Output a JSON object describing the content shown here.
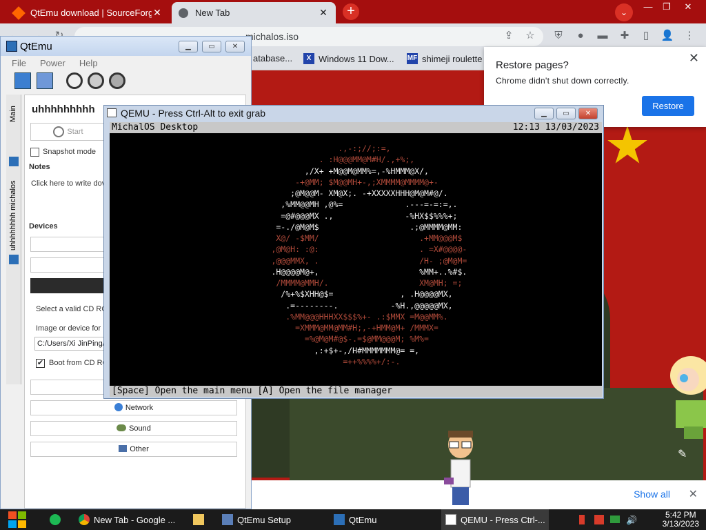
{
  "chrome": {
    "tabs": [
      {
        "title": "QtEmu download | SourceForg"
      },
      {
        "title": "New Tab"
      }
    ],
    "address_visible": "michalos.iso",
    "bookmarks": [
      {
        "label": "atabase..."
      },
      {
        "label": "Windows 11 Dow..."
      },
      {
        "label": "shimeji roulette"
      }
    ],
    "restore": {
      "title": "Restore pages?",
      "desc": "Chrome didn't shut down correctly.",
      "button": "Restore"
    },
    "show_all": "Show all"
  },
  "qtemu": {
    "title": "QtEmu",
    "menu": [
      "File",
      "Power",
      "Help"
    ],
    "side_tabs": [
      "Main",
      "uhhhhhhhh michalos"
    ],
    "vm_name": "uhhhhhhhhh",
    "start_label": "Start",
    "snapshot_label": "Snapshot mode",
    "notes_heading": "Notes",
    "notes_placeholder": "Click here to write dov",
    "devices_heading": "Devices",
    "cd_hint": "Select a valid CD RO",
    "image_label": "Image or device for",
    "image_path": "C:/Users/Xi JinPing/",
    "boot_label": "Boot from CD RO",
    "device_buttons": [
      "Network",
      "Sound",
      "Other"
    ]
  },
  "qemu": {
    "title": "QEMU - Press Ctrl-Alt to exit grab",
    "os_name": "MichalOS Desktop",
    "os_time": "12:13 13/03/2023",
    "footer": "[Space] Open the main menu [A] Open the file manager",
    "ascii_lines": [
      {
        "text": "                     .,-:;//;:=,",
        "tone": "r"
      },
      {
        "text": "                 . :H@@@MM@M#H/.,+%;,",
        "tone": "r"
      },
      {
        "text": "              ,/X+ +M@@M@MM%=,-%HMMM@X/,",
        "tone": "w"
      },
      {
        "text": "            -+@MM; $M@@MH+-,;XMMMM@MMMM@+-",
        "tone": "r"
      },
      {
        "text": "           ;@M@@M- XM@X;. -+XXXXXHHH@M@M#@/.",
        "tone": "w"
      },
      {
        "text": "         ,%MM@@MH ,@%=             .---=-=:=,.",
        "tone": "w"
      },
      {
        "text": "         =@#@@@MX .,               -%HX$$%%%+;",
        "tone": "w"
      },
      {
        "text": "        =-./@M@M$                   .;@MMMM@MM:",
        "tone": "w"
      },
      {
        "text": "        X@/ -$MM/                     .+MM@@@M$",
        "tone": "r"
      },
      {
        "text": "       ,@M@H: :@:                     . =X#@@@@-",
        "tone": "r"
      },
      {
        "text": "       ,@@@MMX, .                     /H- ;@M@M=",
        "tone": "r"
      },
      {
        "text": "       .H@@@@M@+,                     %MM+..%#$.",
        "tone": "w"
      },
      {
        "text": "        /MMMM@MMH/.                   XM@MH; =;",
        "tone": "r"
      },
      {
        "text": "         /%+%$XHH@$=              , .H@@@@MX,",
        "tone": "w"
      },
      {
        "text": "          .=--------.           -%H.,@@@@@MX,",
        "tone": "w"
      },
      {
        "text": "          .%MM@@@HHHXX$$$%+- .:$MMX =M@@MM%.",
        "tone": "r"
      },
      {
        "text": "            =XMMM@MM@MM#H;,-+HMM@M+ /MMMX=",
        "tone": "r"
      },
      {
        "text": "              =%@M@M#@$-.=$@MM@@@M; %M%=",
        "tone": "r"
      },
      {
        "text": "                ,:+$+-,/H#MMMMMMM@= =,",
        "tone": "w"
      },
      {
        "text": "                      =++%%%%+/:-.",
        "tone": "r"
      }
    ]
  },
  "taskbar": {
    "items": [
      "New Tab - Google ...",
      "",
      "QtEmu Setup",
      "QtEmu",
      "QEMU - Press Ctrl-..."
    ],
    "time": "5:42 PM",
    "date": "3/13/2023"
  }
}
